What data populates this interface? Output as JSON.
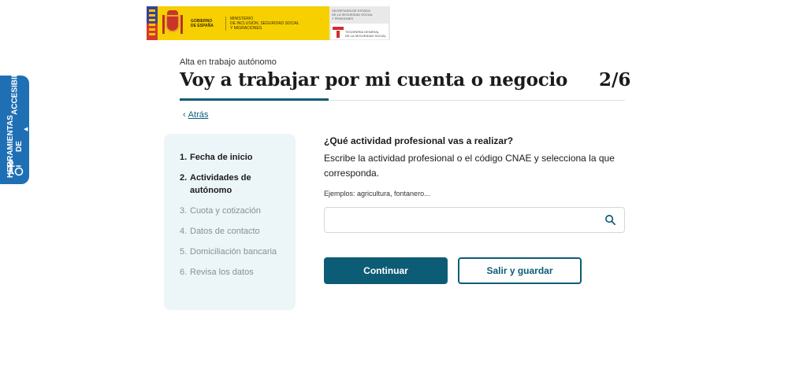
{
  "header": {
    "gov_name_line1": "GOBIERNO",
    "gov_name_line2": "DE ESPAÑA",
    "ministry_line1": "MINISTERIO",
    "ministry_line2": "DE INCLUSIÓN, SEGURIDAD SOCIAL",
    "ministry_line3": "Y MIGRACIONES",
    "secretary_line1": "SECRETARÍA DE ESTADO",
    "secretary_line2": "DE LA SEGURIDAD SOCIAL",
    "secretary_line3": "Y PENSIONES",
    "tgss_line1": "TESORERÍA GENERAL",
    "tgss_line2": "DE LA SEGURIDAD SOCIAL"
  },
  "accessibility": {
    "line1": "HERRAMIENTAS DE",
    "line2": "ACCESIBILIDAD"
  },
  "page": {
    "kicker": "Alta en trabajo autónomo",
    "title": "Voy a trabajar por mi cuenta o negocio",
    "step_indicator": "2/6",
    "back_label": "Atrás"
  },
  "steps": [
    {
      "num": "1.",
      "label": "Fecha de inicio",
      "state": "done"
    },
    {
      "num": "2.",
      "label": "Actividades de autónomo",
      "state": "active"
    },
    {
      "num": "3.",
      "label": "Cuota y cotización",
      "state": "pending"
    },
    {
      "num": "4.",
      "label": "Datos de contacto",
      "state": "pending"
    },
    {
      "num": "5.",
      "label": "Domiciliación bancaria",
      "state": "pending"
    },
    {
      "num": "6.",
      "label": "Revisa los datos",
      "state": "pending"
    }
  ],
  "form": {
    "question": "¿Qué actividad profesional vas a realizar?",
    "description": "Escribe la actividad profesional o el código CNAE y selecciona la que corresponda.",
    "examples": "Ejemplos: agricultura, fontanero...",
    "search_value": "",
    "search_placeholder": ""
  },
  "actions": {
    "continue_label": "Continuar",
    "save_exit_label": "Salir y guardar"
  },
  "colors": {
    "primary": "#0d5c76",
    "accessibility_tab": "#1f6fb5",
    "steps_panel_bg": "#ecf6f8",
    "gov_yellow": "#f6d000"
  }
}
